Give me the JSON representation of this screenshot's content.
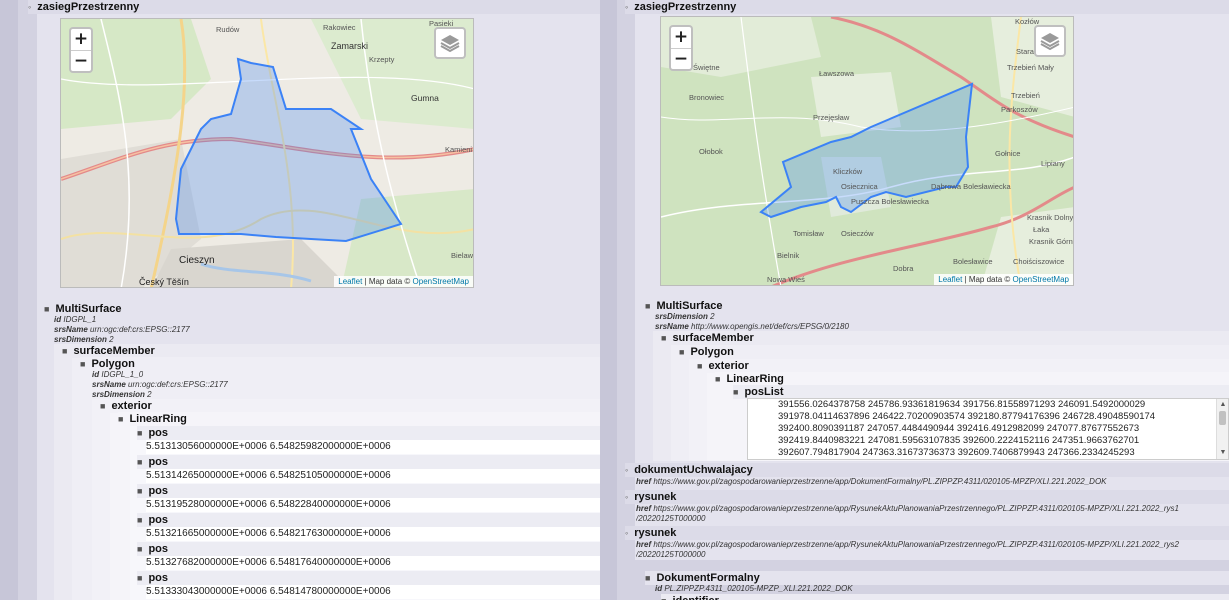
{
  "left": {
    "title": "zasiegPrzestrzenny",
    "map": {
      "zoom_in": "+",
      "zoom_out": "−",
      "attribution_leaflet": "Leaflet",
      "attribution_sep": " | Map data © ",
      "attribution_osm": "OpenStreetMap",
      "places": [
        "Rudów",
        "Rakowiec",
        "Zamarski",
        "Pasieki",
        "Krzepty",
        "Gumna",
        "Kamieni",
        "Cieszyn",
        "Český Těšín",
        "Bielaw"
      ]
    },
    "multisurface": {
      "title": "MultiSurface",
      "id_key": "id",
      "id_val": "IDGPL_1",
      "srs_key": "srsName",
      "srs_val": "urn:ogc:def:crs:EPSG::2177",
      "dim_key": "srsDimension",
      "dim_val": "2"
    },
    "surface_member": "surfaceMember",
    "polygon": {
      "title": "Polygon",
      "id_key": "id",
      "id_val": "IDGPL_1_0",
      "srs_key": "srsName",
      "srs_val": "urn:ogc:def:crs:EPSG::2177",
      "dim_key": "srsDimension",
      "dim_val": "2"
    },
    "exterior": "exterior",
    "linear_ring": "LinearRing",
    "pos_label": "pos",
    "pos_values": [
      "5.51313056000000E+0006 6.54825982000000E+0006",
      "5.51314265000000E+0006 6.54825105000000E+0006",
      "5.51319528000000E+0006 6.54822840000000E+0006",
      "5.51321665000000E+0006 6.54821763000000E+0006",
      "5.51327682000000E+0006 6.54817640000000E+0006",
      "5.51333043000000E+0006 6.54814780000000E+0006"
    ]
  },
  "right": {
    "title": "zasiegPrzestrzenny",
    "map": {
      "zoom_in": "+",
      "zoom_out": "−",
      "attribution_leaflet": "Leaflet",
      "attribution_sep": " | Map data © ",
      "attribution_osm": "OpenStreetMap",
      "places": [
        "Kozłów",
        "Stara Olesz",
        "Świętne",
        "Ławszowa",
        "Trzebień Mały",
        "Bronowiec",
        "Trzebień",
        "Parkoszów",
        "Przejęsław",
        "Ołobok",
        "Gołnice",
        "Lipiany",
        "Kliczków",
        "Osiecznica",
        "Dąbrowa Bolesławiecka",
        "Puszcza Bolesławiecka",
        "Krasnik Dolny",
        "Łaka",
        "Tomisław",
        "Osieczów",
        "Krasnik Górny",
        "Bielnik",
        "Bolesławice",
        "Choiściszowice",
        "Dobra",
        "Nowa Wieś"
      ]
    },
    "multisurface": {
      "title": "MultiSurface",
      "dim_key": "srsDimension",
      "dim_val": "2",
      "srs_key": "srsName",
      "srs_val": "http://www.opengis.net/def/crs/EPSG/0/2180"
    },
    "surface_member": "surfaceMember",
    "polygon": "Polygon",
    "exterior": "exterior",
    "linear_ring": "LinearRing",
    "poslist_label": "posList",
    "poslist_lines": [
      "391556.0264378758 245786.93361819634 391756.81558971293 246091.5492000029",
      "391978.04114637896 246422.70200903574 392180.87794176396 246728.49048590174",
      "392400.8090391187 247057.4484490944 392416.4912982099 247077.87677552673",
      "392419.8440983221 247081.59563107835 392600.2224152116 247351.9663762701",
      "392607.794817904 247363.31673736373 392609.7406879943 247366.2334245293"
    ],
    "dokument": {
      "title": "dokumentUchwalajacy",
      "href_key": "href",
      "href_val": "https://www.gov.pl/zagospodarowanieprzestrzenne/app/DokumentFormalny/PL.ZIPPZP.4311/020105-MPZP/XLI.221.2022_DOK"
    },
    "rysunek1": {
      "title": "rysunek",
      "href_key": "href",
      "href_line1": "https://www.gov.pl/zagospodarowanieprzestrzenne/app/RysunekAktuPlanowaniaPrzestrzennego/PL.ZIPPZP.4311/020105-MPZP/XLI.221.2022_rys1",
      "href_line2": "/20220125T000000"
    },
    "rysunek2": {
      "title": "rysunek",
      "href_key": "href",
      "href_line1": "https://www.gov.pl/zagospodarowanieprzestrzenne/app/RysunekAktuPlanowaniaPrzestrzennego/PL.ZIPPZP.4311/020105-MPZP/XLI.221.2022_rys2",
      "href_line2": "/20220125T000000"
    },
    "dokument_formalny": {
      "title": "DokumentFormalny",
      "id_key": "id",
      "id_val": "PL.ZIPPZP.4311_020105-MPZP_XLI.221.2022_DOK"
    },
    "identifier": "identifier"
  },
  "bullets": {
    "open": "◦",
    "filled": "■"
  },
  "scroll": {
    "up": "▲",
    "down": "▼"
  },
  "colors": {
    "background": "#c7c6d8",
    "header": "#dcdbe8",
    "polygon_stroke": "#3b82f6",
    "polygon_fill": "#3b82f6"
  }
}
